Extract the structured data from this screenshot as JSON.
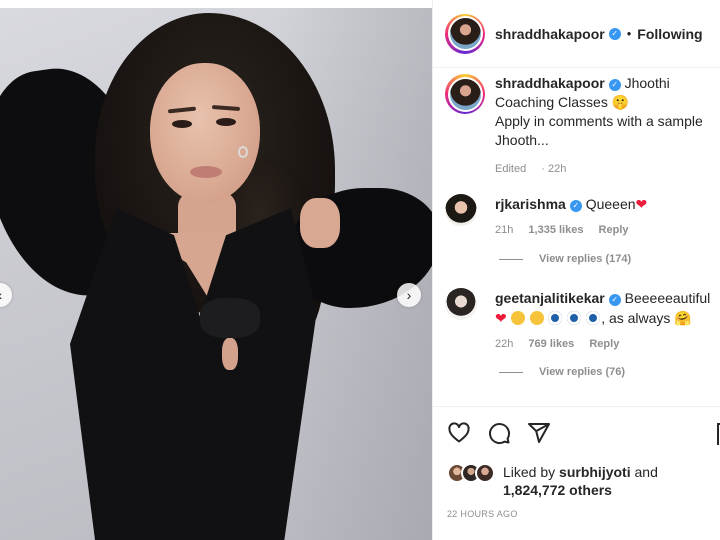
{
  "post": {
    "author": "shraddhakapoor",
    "follow_state": "Following",
    "separator": "•"
  },
  "caption": {
    "author": "shraddhakapoor",
    "line1": "Jhoothi Coaching Classes",
    "emoji": "🤫",
    "line2": "Apply in comments with a sample Jhooth...",
    "edited": "Edited",
    "time": "22h"
  },
  "comments": [
    {
      "user": "rjkarishma",
      "text": "Queeen",
      "emoji": "❤",
      "time": "21h",
      "likes": "1,335 likes",
      "reply": "Reply",
      "view_replies": "View replies (174)"
    },
    {
      "user": "geetanjalitikekar",
      "text": "Beeeeeautiful",
      "tail": ", as always",
      "tail_emoji": "🤗",
      "time": "22h",
      "likes": "769 likes",
      "reply": "Reply",
      "view_replies": "View replies (76)"
    }
  ],
  "actions": {
    "icons": [
      "heart-icon",
      "comment-icon",
      "share-icon",
      "save-icon"
    ]
  },
  "likes": {
    "prefix": "Liked by",
    "user": "surbhijyoti",
    "joiner": "and",
    "count": "1,824,772 others"
  },
  "timestamp": "22 HOURS AGO",
  "colors": {
    "verified": "#3897f0",
    "muted": "#8e8e8e",
    "text": "#262626"
  }
}
